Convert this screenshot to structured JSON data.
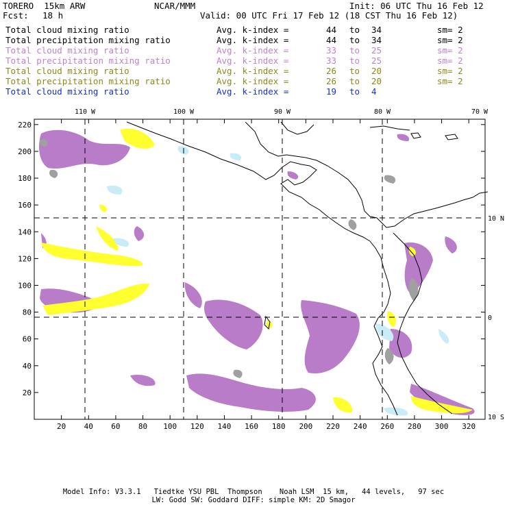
{
  "header": {
    "model": "TORERO  15km ARW",
    "center": "NCAR/MMM",
    "init": "Init: 06 UTC Thu 16 Feb 12",
    "fcst_label": "Fcst:",
    "fcst_value": "18 h",
    "valid": "Valid: 00 UTC Fri 17 Feb 12 (18 CST Thu 16 Feb 12)"
  },
  "legend": [
    {
      "field": "Total cloud mixing ratio",
      "k_label": "Avg. k-index =",
      "k_from": "44",
      "to": "to",
      "k_to": "34",
      "sm": "sm= 2",
      "color": "#000000"
    },
    {
      "field": "Total precipitation mixing ratio",
      "k_label": "Avg. k-index =",
      "k_from": "44",
      "to": "to",
      "k_to": "34",
      "sm": "sm= 2",
      "color": "#000000"
    },
    {
      "field": "Total cloud mixing ratio",
      "k_label": "Avg. k-index =",
      "k_from": "33",
      "to": "to",
      "k_to": "25",
      "sm": "sm= 2",
      "color": "#c080d0"
    },
    {
      "field": "Total precipitation mixing ratio",
      "k_label": "Avg. k-index =",
      "k_from": "33",
      "to": "to",
      "k_to": "25",
      "sm": "sm= 2",
      "color": "#c080d0"
    },
    {
      "field": "Total cloud mixing ratio",
      "k_label": "Avg. k-index =",
      "k_from": "26",
      "to": "to",
      "k_to": "20",
      "sm": "sm= 2",
      "color": "#8a8a1a"
    },
    {
      "field": "Total precipitation mixing ratio",
      "k_label": "Avg. k-index =",
      "k_from": "26",
      "to": "to",
      "k_to": "20",
      "sm": "sm= 2",
      "color": "#8a8a1a"
    },
    {
      "field": "Total cloud mixing ratio",
      "k_label": "Avg. k-index =",
      "k_from": "19",
      "to": "to",
      "k_to": "4",
      "sm": "",
      "color": "#1030d0"
    }
  ],
  "map": {
    "x_ticks": [
      "20",
      "40",
      "60",
      "80",
      "100",
      "120",
      "140",
      "160",
      "180",
      "200",
      "220",
      "240",
      "260",
      "280",
      "300",
      "320"
    ],
    "y_ticks": [
      "20",
      "40",
      "60",
      "80",
      "100",
      "120",
      "140",
      "160",
      "180",
      "200",
      "220"
    ],
    "lon_labels": [
      "110 W",
      "100 W",
      "90 W",
      "80 W",
      "70 W"
    ],
    "lat_labels": [
      "10 N",
      "0",
      "10 S"
    ],
    "colors": {
      "gray": "#a0a0a0",
      "purple": "#b87cc8",
      "yellow": "#ffff30",
      "cyan": "#c8ecf8",
      "coast": "#000000",
      "grid": "#000000"
    }
  },
  "footer": {
    "line1": "Model Info: V3.3.1   Tiedtke YSU PBL  Thompson    Noah LSM  15 km,   44 levels,   97 sec",
    "line2": "LW: Godd SW: Goddard DIFF: simple KM: 2D Smagor"
  }
}
